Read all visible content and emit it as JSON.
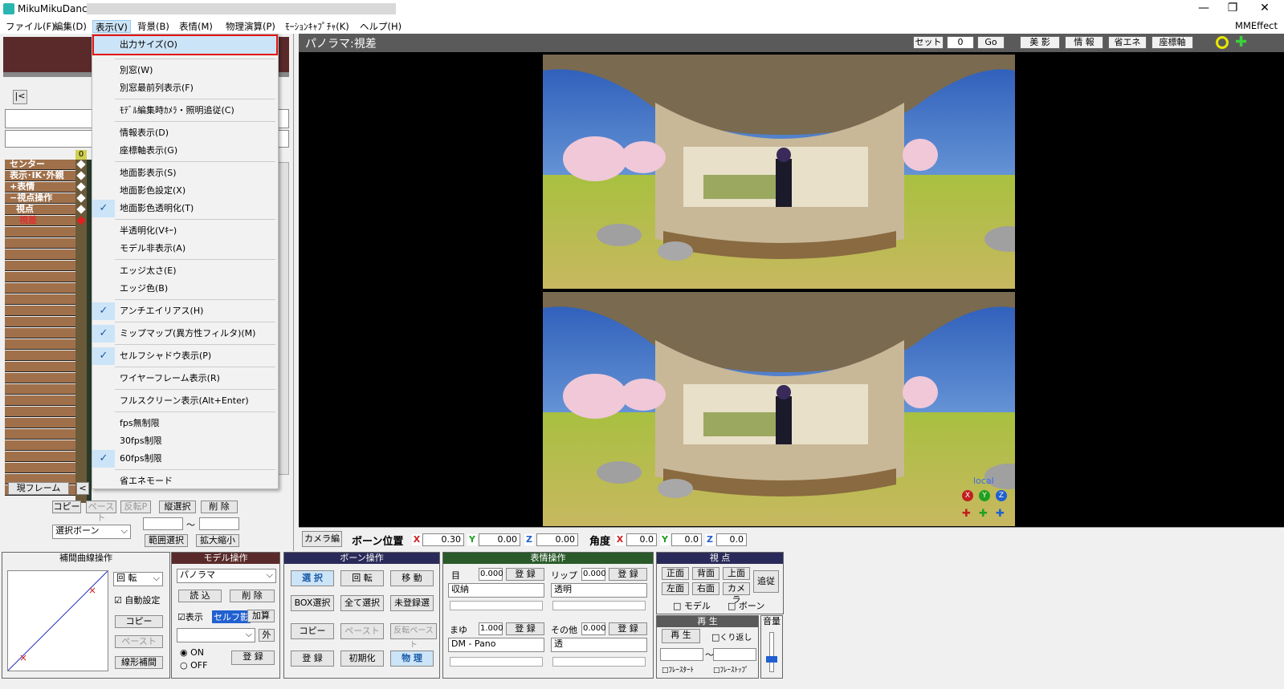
{
  "window": {
    "app_title": "MikuMikuDance",
    "minimize_glyph": "—",
    "restore_glyph": "❐",
    "close_glyph": "✕"
  },
  "menubar": {
    "items": [
      "ファイル(F)",
      "編集(D)",
      "表示(V)",
      "背景(B)",
      "表情(M)",
      "物理演算(P)",
      "ﾓｰｼｮﾝｷｬﾌﾟﾁｬ(K)",
      "ヘルプ(H)"
    ],
    "right_label": "MMEffect"
  },
  "view_menu": {
    "items": [
      {
        "label": "出力サイズ(O)",
        "checked": false
      },
      {
        "label": "別窓(W)",
        "checked": false
      },
      {
        "label": "別窓最前列表示(F)",
        "checked": false
      },
      {
        "label": "ﾓﾃﾞﾙ編集時ｶﾒﾗ・照明追従(C)",
        "checked": false
      },
      {
        "label": "情報表示(D)",
        "checked": false
      },
      {
        "label": "座標軸表示(G)",
        "checked": false
      },
      {
        "label": "地面影表示(S)",
        "checked": false
      },
      {
        "label": "地面影色設定(X)",
        "checked": false
      },
      {
        "label": "地面影色透明化(T)",
        "checked": true
      },
      {
        "label": "半透明化(Vｷｰ)",
        "checked": false
      },
      {
        "label": "モデル非表示(A)",
        "checked": false
      },
      {
        "label": "エッジ太さ(E)",
        "checked": false
      },
      {
        "label": "エッジ色(B)",
        "checked": false
      },
      {
        "label": "アンチエイリアス(H)",
        "checked": true
      },
      {
        "label": "ミップマップ(異方性フィルタ)(M)",
        "checked": true
      },
      {
        "label": "セルフシャドウ表示(P)",
        "checked": true
      },
      {
        "label": "ワイヤーフレーム表示(R)",
        "checked": false
      },
      {
        "label": "フルスクリーン表示(Alt+Enter)",
        "checked": false
      },
      {
        "label": "fps無制限",
        "checked": false
      },
      {
        "label": "30fps制限",
        "checked": false
      },
      {
        "label": "60fps制限",
        "checked": true
      },
      {
        "label": "省エネモード",
        "checked": false
      }
    ],
    "check_glyph": "✓"
  },
  "timeline": {
    "rows": [
      "センター",
      "表示･IK･外親",
      "+表情",
      "−視点操作",
      "視点",
      "視差"
    ],
    "frame_zero": "0",
    "current_frame_label": "現フレーム",
    "nav_left": "|<",
    "nav_prev": "<",
    "buttons": {
      "copy": "コピー",
      "paste": "ペースト",
      "reverse": "反転P",
      "vertical_select": "縦選択",
      "delete": "削 除",
      "range_select": "範囲選択",
      "scale": "拡大縮小",
      "bone_select": "選択ボーン",
      "tilde": "〜"
    }
  },
  "viewport": {
    "title": "パノラマ:視差",
    "set_label": "セット",
    "frame_value": "0",
    "go_label": "Go",
    "buttons": [
      "美 影",
      "情 報",
      "省エネ",
      "座標軸"
    ],
    "local_label": "local",
    "axis_labels": [
      "X",
      "Y",
      "Z"
    ]
  },
  "bone_bar": {
    "camera_edit": "カメラ編",
    "position_label": "ボーン位置",
    "x_value": "0.30",
    "y_value": "0.00",
    "z_value": "0.00",
    "angle_label": "角度",
    "ax_value": "0.0",
    "ay_value": "0.0",
    "az_value": "0.0",
    "x": "X",
    "y": "Y",
    "z": "Z"
  },
  "interp_panel": {
    "title": "補間曲線操作",
    "rotate": "回 転",
    "auto_setting": "自動設定",
    "copy": "コピー",
    "paste": "ペースト",
    "linear": "線形補間"
  },
  "model_panel": {
    "title": "モデル操作",
    "model_name": "パノラマ",
    "load": "読 込",
    "delete": "削 除",
    "display": "表示",
    "self_shadow": "セルフ影",
    "add": "加算",
    "outer": "外",
    "on": "ON",
    "off": "OFF",
    "register": "登 録"
  },
  "bone_panel": {
    "title": "ボーン操作",
    "select": "選 択",
    "rotate": "回 転",
    "move": "移 動",
    "box_select": "BOX選択",
    "select_all": "全て選択",
    "unregistered": "未登録選",
    "copy": "コピー",
    "paste": "ペースト",
    "reverse_paste": "反転ペースト",
    "register": "登 録",
    "initialize": "初期化",
    "physics": "物 理"
  },
  "expression_panel": {
    "title": "表情操作",
    "eye_label": "目",
    "eye_value": "0.000",
    "lip_label": "リップ",
    "lip_value": "0.000",
    "eyebrow_label": "まゆ",
    "eyebrow_value": "1.000",
    "other_label": "その他",
    "other_value": "0.000",
    "register": "登 録",
    "eye_select": "収納",
    "lip_select": "透明",
    "eyebrow_select": "DM - Pano",
    "other_select": "透"
  },
  "view_panel": {
    "title": "視 点",
    "front": "正面",
    "back": "背面",
    "top": "上面",
    "left": "左面",
    "right": "右面",
    "camera": "カメラ",
    "follow": "追従",
    "model": "モデル",
    "bone": "ボーン"
  },
  "play_panel": {
    "title": "再 生",
    "play": "再 生",
    "repeat": "くり返し",
    "frame_start": "ﾌﾚｰｽﾀｰﾄ",
    "frame_stop": "ﾌﾚｰｽﾄｯﾌﾟ",
    "tilde": "〜"
  },
  "volume_panel": {
    "title": "音量"
  }
}
